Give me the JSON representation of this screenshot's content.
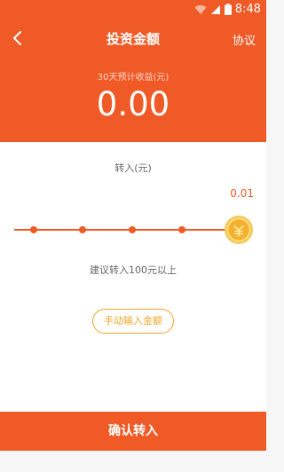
{
  "status_bar": {
    "time": "8:48"
  },
  "header": {
    "title": "投资金额",
    "agreement_label": "协议",
    "earnings_label": "30天预计收益(元)",
    "earnings_value": "0.00"
  },
  "transfer": {
    "label": "转入(元)",
    "current_value": "0.01",
    "slider_level": 1.0,
    "hint": "建议转入100元以上",
    "manual_button_label": "手动输入金额"
  },
  "footer": {
    "confirm_label": "确认转入"
  },
  "colors": {
    "accent": "#ef5a26",
    "coin": "#f3b12f"
  },
  "icons": [
    "wifi-icon",
    "signal-icon",
    "battery-icon",
    "back-arrow-icon",
    "coin-icon"
  ]
}
